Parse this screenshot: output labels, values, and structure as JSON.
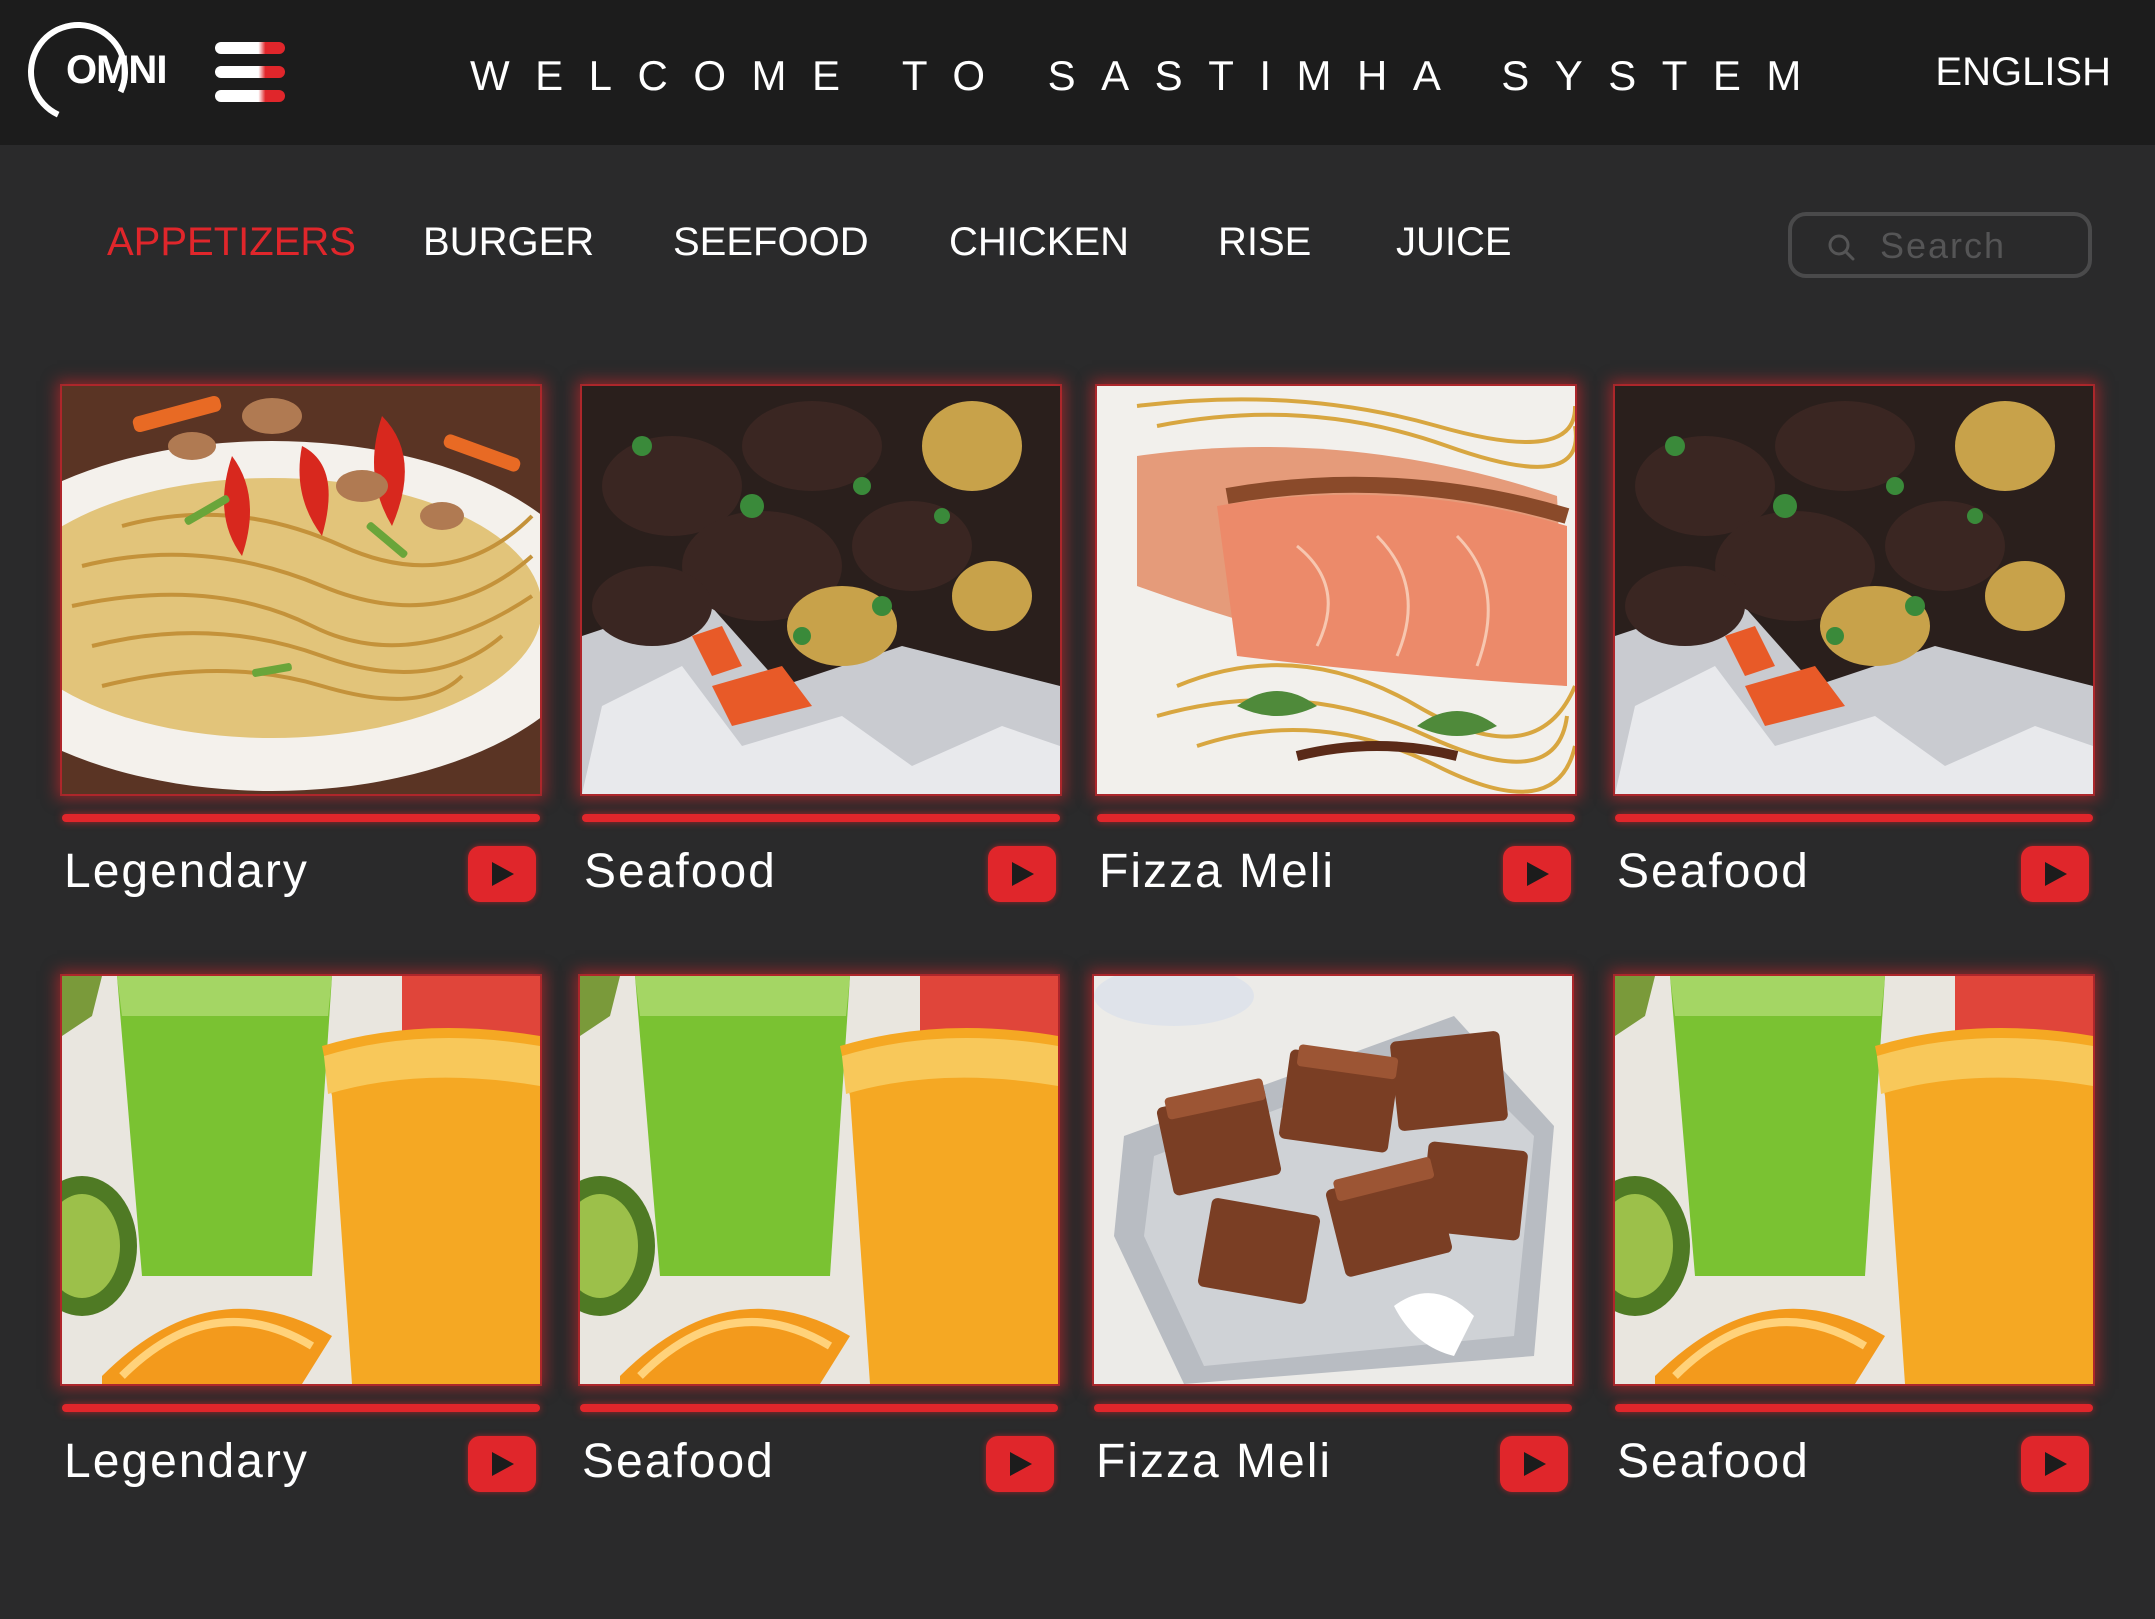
{
  "header": {
    "logo_text": "OMNI",
    "welcome": "WELCOME TO SASTIMHA SYSTEM",
    "language": "ENGLISH"
  },
  "tabs": [
    {
      "label": "APPETIZERS",
      "active": true
    },
    {
      "label": "BURGER",
      "active": false
    },
    {
      "label": "SEEFOOD",
      "active": false
    },
    {
      "label": "CHICKEN",
      "active": false
    },
    {
      "label": "RISE",
      "active": false
    },
    {
      "label": "JUICE",
      "active": false
    }
  ],
  "search": {
    "placeholder": "Search",
    "value": ""
  },
  "items": [
    {
      "title": "Legendary",
      "image": "noodle-stir-fry"
    },
    {
      "title": "Seafood",
      "image": "grilled-beef-potatoes-foil"
    },
    {
      "title": "Fizza Meli",
      "image": "salmon-fillet-noodles"
    },
    {
      "title": "Seafood",
      "image": "grilled-beef-potatoes-foil"
    },
    {
      "title": "Legendary",
      "image": "green-and-orange-juice"
    },
    {
      "title": "Seafood",
      "image": "green-and-orange-juice"
    },
    {
      "title": "Fizza Meli",
      "image": "brownie-squares-tin"
    },
    {
      "title": "Seafood",
      "image": "green-and-orange-juice"
    }
  ],
  "colors": {
    "accent": "#e0262b",
    "background": "#2a2a2b",
    "header": "#1c1c1c"
  }
}
